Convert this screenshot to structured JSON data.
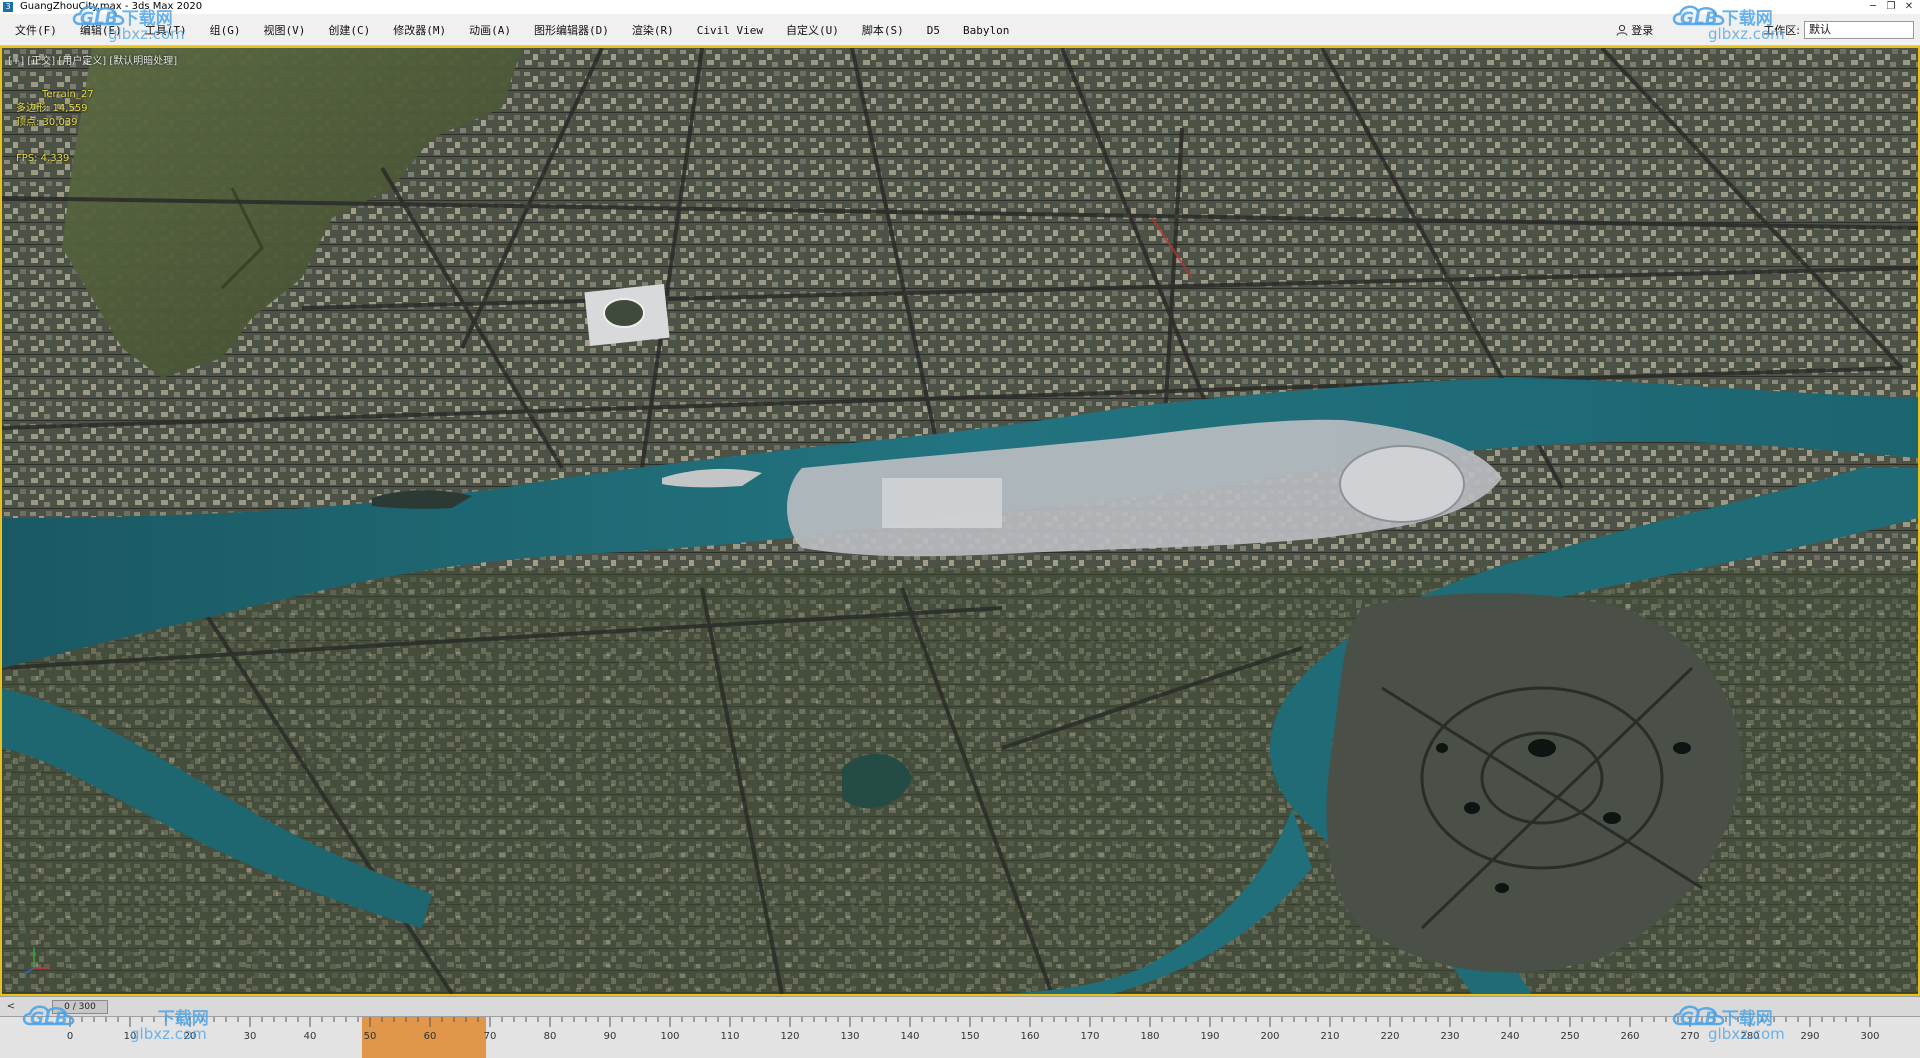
{
  "titlebar": {
    "title": "GuangZhouCity.max - 3ds Max 2020",
    "app_icon": "3",
    "minimize": "─",
    "restore": "❐",
    "close": "✕"
  },
  "menu": {
    "items": [
      {
        "label": "文件(F)"
      },
      {
        "label": "编辑(E)"
      },
      {
        "label": "工具(T)"
      },
      {
        "label": "组(G)"
      },
      {
        "label": "视图(V)"
      },
      {
        "label": "创建(C)"
      },
      {
        "label": "修改器(M)"
      },
      {
        "label": "动画(A)"
      },
      {
        "label": "图形编辑器(D)"
      },
      {
        "label": "渲染(R)"
      },
      {
        "label": "Civil View"
      },
      {
        "label": "自定义(U)"
      },
      {
        "label": "脚本(S)"
      },
      {
        "label": "D5"
      },
      {
        "label": "Babylon"
      }
    ],
    "login_label": "登录",
    "workspace_label": "工作区:",
    "workspace_value": "默认"
  },
  "viewport": {
    "label": "[+] [正交] [用户定义] [默认明暗处理]",
    "stats": {
      "object": "Terrain_27",
      "polys": "多边形: 14,559",
      "verts": "顶点: 30,039",
      "fps": "FPS: 4.339"
    },
    "colors": {
      "border": "#e6c21a",
      "river": "#1f6f78",
      "island": "#b9bcc0",
      "mountain": "#4a5634"
    }
  },
  "timeslider": {
    "prev": "<",
    "value": "0 / 300"
  },
  "trackbar": {
    "ticks": [
      "0",
      "10",
      "20",
      "30",
      "40",
      "50",
      "60",
      "70",
      "80",
      "90",
      "100",
      "110",
      "120",
      "130",
      "140",
      "150",
      "160",
      "170",
      "180",
      "190",
      "200",
      "210",
      "220",
      "230",
      "240",
      "250",
      "260",
      "270",
      "280",
      "290",
      "300"
    ]
  },
  "watermark": {
    "glb": "GLB",
    "cn": "下载网",
    "url": "glbxz.com"
  }
}
